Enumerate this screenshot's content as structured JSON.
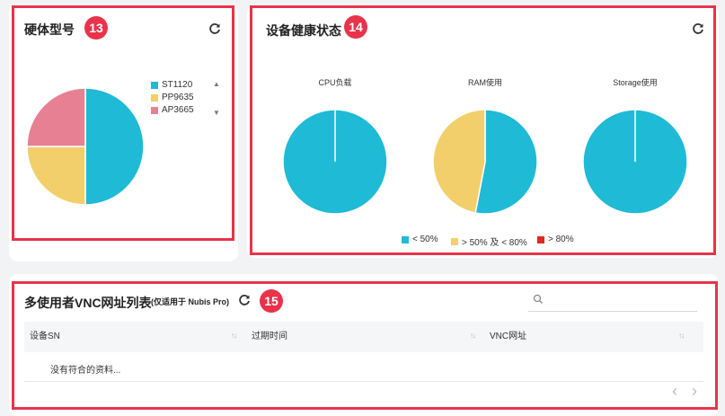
{
  "hardware_model": {
    "title": "硬体型号",
    "badge": "13",
    "legend": [
      {
        "label": "ST1120",
        "color": "#1fbad6"
      },
      {
        "label": "PP9635",
        "color": "#f2cf6a"
      },
      {
        "label": "AP3665",
        "color": "#e88093"
      }
    ],
    "pager_up": "▲",
    "pager_down": "▼"
  },
  "device_health": {
    "title": "设备健康状态",
    "badge": "14",
    "pies": [
      {
        "label": "CPU负载"
      },
      {
        "label": "RAM使用"
      },
      {
        "label": "Storage使用"
      }
    ],
    "legend": [
      {
        "label": "< 50%",
        "color": "#1fbad6"
      },
      {
        "label": "> 50% 及 < 80%",
        "color": "#f2cf6a"
      },
      {
        "label": "> 80%",
        "color": "#e0281e"
      }
    ]
  },
  "vnc_list": {
    "title": "多使用者VNC网址列表",
    "subtitle": "(仅适用于 Nubis Pro)",
    "badge": "15",
    "search_placeholder": "",
    "columns": [
      "设备SN",
      "过期时间",
      "VNC网址"
    ],
    "empty_text": "没有符合的资料...",
    "prev": "‹",
    "next": "›"
  },
  "chart_data": [
    {
      "type": "pie",
      "title": "硬体型号",
      "categories": [
        "ST1120",
        "PP9635",
        "AP3665"
      ],
      "values": [
        50,
        25,
        25
      ]
    },
    {
      "type": "pie",
      "title": "CPU负载",
      "categories": [
        "< 50%",
        "> 50% 及 < 80%",
        "> 80%"
      ],
      "values": [
        100,
        0,
        0
      ]
    },
    {
      "type": "pie",
      "title": "RAM使用",
      "categories": [
        "< 50%",
        "> 50% 及 < 80%",
        "> 80%"
      ],
      "values": [
        53,
        47,
        0
      ]
    },
    {
      "type": "pie",
      "title": "Storage使用",
      "categories": [
        "< 50%",
        "> 50% 及 < 80%",
        "> 80%"
      ],
      "values": [
        100,
        0,
        0
      ]
    }
  ]
}
